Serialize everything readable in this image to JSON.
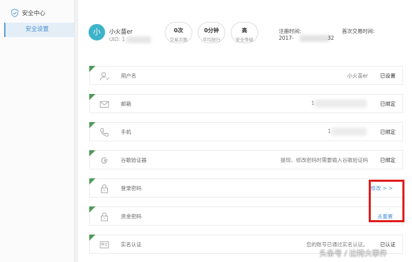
{
  "sidebar": {
    "title": "安全中心",
    "items": [
      {
        "label": "安全设置",
        "active": true
      }
    ]
  },
  "profile": {
    "avatar_letter": "小",
    "username": "小火苗er",
    "uid_label": "UID: 1",
    "stats": [
      {
        "value": "0次",
        "label": "交易次数"
      },
      {
        "value": "0分钟",
        "label": "平均放行"
      },
      {
        "value": "高",
        "label": "安全等级"
      }
    ],
    "register_label": "注册时间:",
    "register_value_prefix": "2017-",
    "register_value_suffix": "32",
    "first_trade_label": "首次交易时间:"
  },
  "security_rows": [
    {
      "icon": "user-icon",
      "label": "用户名",
      "value": "小火苗er",
      "status": "已设置",
      "action": ""
    },
    {
      "icon": "mail-icon",
      "label": "邮箱",
      "value": "1",
      "status": "已绑定",
      "action": ""
    },
    {
      "icon": "phone-icon",
      "label": "手机",
      "value": "1",
      "status": "已绑定",
      "action": ""
    },
    {
      "icon": "google-icon",
      "label": "谷歌验证器",
      "value": "提现、修改密码时需要输入谷歌验证码",
      "status": "已绑定",
      "action": ""
    },
    {
      "icon": "lock-icon",
      "label": "登录密码",
      "value": "",
      "status": "",
      "action": "修改 > >"
    },
    {
      "icon": "lock-icon",
      "label": "资金密码",
      "value": "",
      "status": "",
      "action": "去重置"
    },
    {
      "icon": "id-card-icon",
      "label": "实名认证",
      "value": "您的账号已通过实名认证。",
      "status": "已认证",
      "action": ""
    }
  ],
  "watermark": "头条号 / 比特大事件",
  "colors": {
    "accent": "#4a90d9",
    "avatar": "#3cb3c9",
    "row_marker": "#4f9a58",
    "highlight_box": "#e01a1a"
  }
}
